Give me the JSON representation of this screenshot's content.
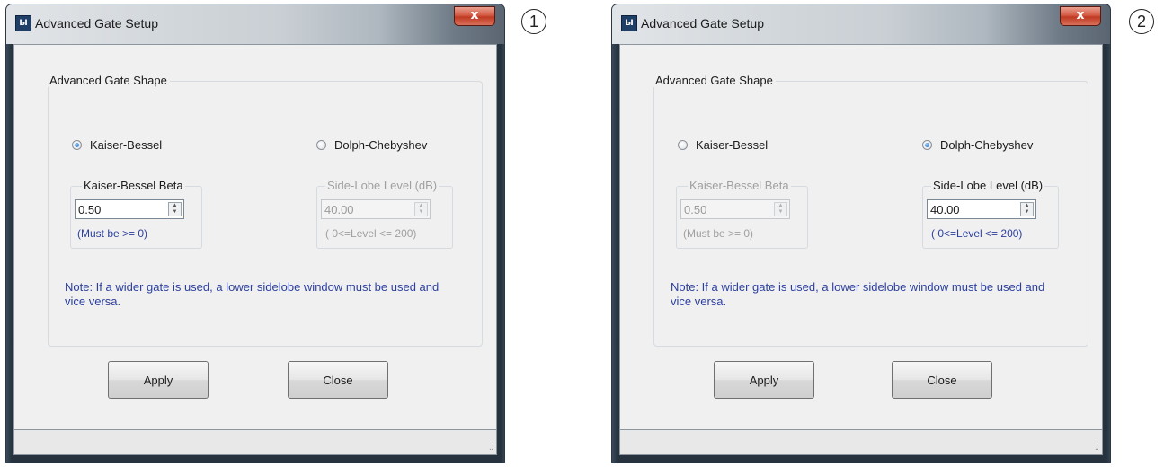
{
  "dialogs": [
    {
      "title": "Advanced Gate Setup",
      "close_glyph": "x",
      "group_title": "Advanced Gate Shape",
      "radio_kaiser_label": "Kaiser-Bessel",
      "radio_kaiser_selected": true,
      "radio_dolph_label": "Dolph-Chebyshev",
      "radio_dolph_selected": false,
      "kaiser_group_title": "Kaiser-Bessel Beta",
      "kaiser_value": "0.50",
      "kaiser_hint": "(Must be >= 0)",
      "kaiser_enabled": true,
      "sidelobe_group_title": "Side-Lobe Level (dB)",
      "sidelobe_value": "40.00",
      "sidelobe_hint": "( 0<=Level <= 200)",
      "sidelobe_enabled": false,
      "note": "Note: If a wider gate is used, a lower sidelobe window must be used and vice versa.",
      "apply_label": "Apply",
      "close_label": "Close",
      "marker": "1"
    },
    {
      "title": "Advanced Gate Setup",
      "close_glyph": "x",
      "group_title": "Advanced Gate Shape",
      "radio_kaiser_label": "Kaiser-Bessel",
      "radio_kaiser_selected": false,
      "radio_dolph_label": "Dolph-Chebyshev",
      "radio_dolph_selected": true,
      "kaiser_group_title": "Kaiser-Bessel Beta",
      "kaiser_value": "0.50",
      "kaiser_hint": "(Must be >= 0)",
      "kaiser_enabled": false,
      "sidelobe_group_title": "Side-Lobe Level (dB)",
      "sidelobe_value": "40.00",
      "sidelobe_hint": "( 0<=Level <= 200)",
      "sidelobe_enabled": true,
      "note": "Note: If a wider gate is used, a lower sidelobe window must be used and vice versa.",
      "apply_label": "Apply",
      "close_label": "Close",
      "marker": "2"
    }
  ],
  "icons": {
    "app": "app-icon",
    "close": "close-icon",
    "spin": "spin-arrows-icon",
    "grip": "resize-grip-icon"
  },
  "colors": {
    "hint_text": "#2b3f9e",
    "close_button": "#c03a22",
    "radio_selected": "#1a62b4"
  }
}
